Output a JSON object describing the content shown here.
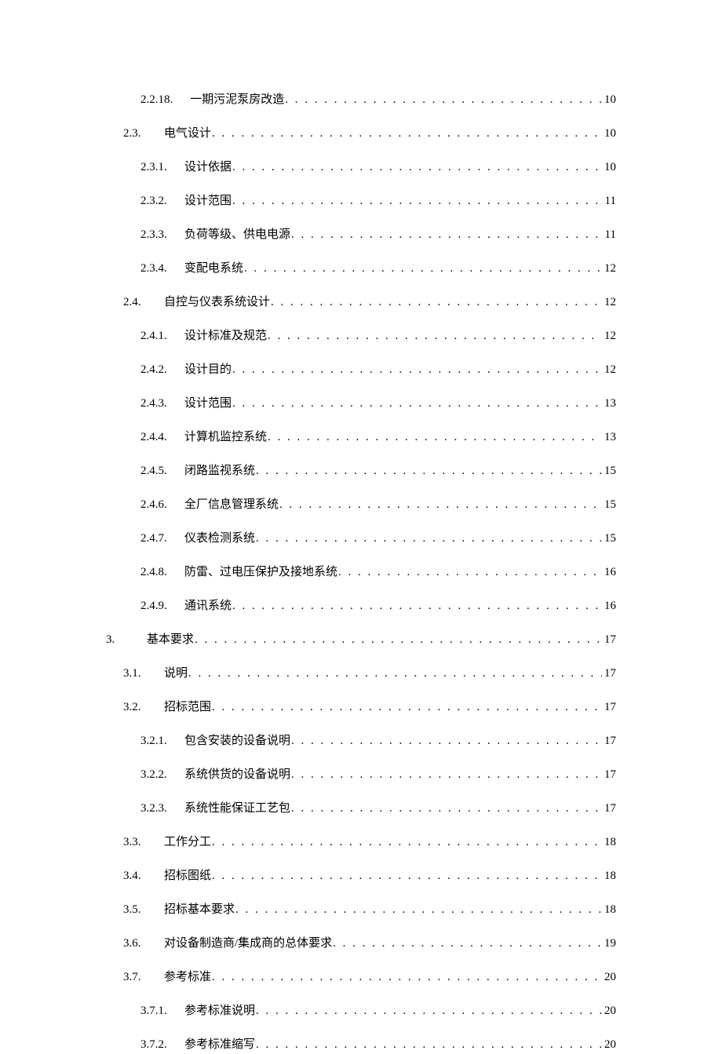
{
  "toc": [
    {
      "level": 3,
      "number": "2.2.18.",
      "title": "一期污泥泵房改造",
      "page": "10"
    },
    {
      "level": 2,
      "number": "2.3.",
      "title": "电气设计",
      "page": "10"
    },
    {
      "level": 3,
      "number": "2.3.1.",
      "title": "设计依据",
      "page": "10"
    },
    {
      "level": 3,
      "number": "2.3.2.",
      "title": "设计范围",
      "page": "11"
    },
    {
      "level": 3,
      "number": "2.3.3.",
      "title": "负荷等级、供电电源",
      "page": "11"
    },
    {
      "level": 3,
      "number": "2.3.4.",
      "title": "变配电系统",
      "page": "12"
    },
    {
      "level": 2,
      "number": "2.4.",
      "title": "自控与仪表系统设计",
      "page": "12"
    },
    {
      "level": 3,
      "number": "2.4.1.",
      "title": "设计标准及规范",
      "page": "12"
    },
    {
      "level": 3,
      "number": "2.4.2.",
      "title": "设计目的",
      "page": "12"
    },
    {
      "level": 3,
      "number": "2.4.3.",
      "title": "设计范围",
      "page": "13"
    },
    {
      "level": 3,
      "number": "2.4.4.",
      "title": "计算机监控系统",
      "page": "13"
    },
    {
      "level": 3,
      "number": "2.4.5.",
      "title": "闭路监视系统",
      "page": "15"
    },
    {
      "level": 3,
      "number": "2.4.6.",
      "title": "全厂信息管理系统",
      "page": "15"
    },
    {
      "level": 3,
      "number": "2.4.7.",
      "title": "仪表检测系统",
      "page": "15"
    },
    {
      "level": 3,
      "number": "2.4.8.",
      "title": "防雷、过电压保护及接地系统",
      "page": "16"
    },
    {
      "level": 3,
      "number": "2.4.9.",
      "title": "通讯系统",
      "page": "16"
    },
    {
      "level": 1,
      "number": "3.",
      "title": "基本要求",
      "page": "17"
    },
    {
      "level": 2,
      "number": "3.1.",
      "title": "说明",
      "page": "17"
    },
    {
      "level": 2,
      "number": "3.2.",
      "title": "招标范围",
      "page": "17"
    },
    {
      "level": 3,
      "number": "3.2.1.",
      "title": "包含安装的设备说明",
      "page": "17"
    },
    {
      "level": 3,
      "number": "3.2.2.",
      "title": "系统供货的设备说明",
      "page": "17"
    },
    {
      "level": 3,
      "number": "3.2.3.",
      "title": "系统性能保证工艺包",
      "page": "17"
    },
    {
      "level": 2,
      "number": "3.3.",
      "title": "工作分工",
      "page": "18"
    },
    {
      "level": 2,
      "number": "3.4.",
      "title": "招标图纸",
      "page": "18"
    },
    {
      "level": 2,
      "number": "3.5.",
      "title": "招标基本要求",
      "page": "18"
    },
    {
      "level": 2,
      "number": "3.6.",
      "title": "对设备制造商/集成商的总体要求",
      "page": "19"
    },
    {
      "level": 2,
      "number": "3.7.",
      "title": "参考标准",
      "page": "20"
    },
    {
      "level": 3,
      "number": "3.7.1.",
      "title": "参考标准说明",
      "page": "20"
    },
    {
      "level": 3,
      "number": "3.7.2.",
      "title": "参考标准缩写",
      "page": "20"
    }
  ]
}
